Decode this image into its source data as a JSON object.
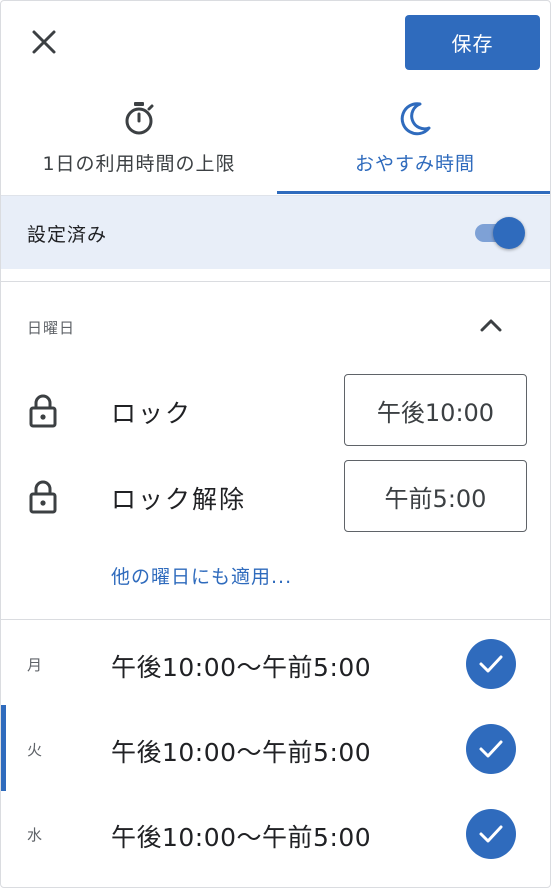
{
  "header": {
    "save_label": "保存"
  },
  "tabs": [
    {
      "label": "1日の利用時間の上限",
      "icon": "timer-icon"
    },
    {
      "label": "おやすみ時間",
      "icon": "moon-icon",
      "active": true
    }
  ],
  "status": {
    "label": "設定済み",
    "enabled": true
  },
  "schedule": {
    "day_heading": "日曜日",
    "lock": {
      "label": "ロック",
      "time": "午後10:00"
    },
    "unlock": {
      "label": "ロック解除",
      "time": "午前5:00"
    },
    "apply_link": "他の曜日にも適用..."
  },
  "week": [
    {
      "day": "月",
      "range": "午後10:00〜午前5:00",
      "checked": true
    },
    {
      "day": "火",
      "range": "午後10:00〜午前5:00",
      "checked": true
    },
    {
      "day": "水",
      "range": "午後10:00〜午前5:00",
      "checked": true
    }
  ],
  "colors": {
    "accent": "#2f6bbd",
    "status_bg": "#e8eef8"
  }
}
